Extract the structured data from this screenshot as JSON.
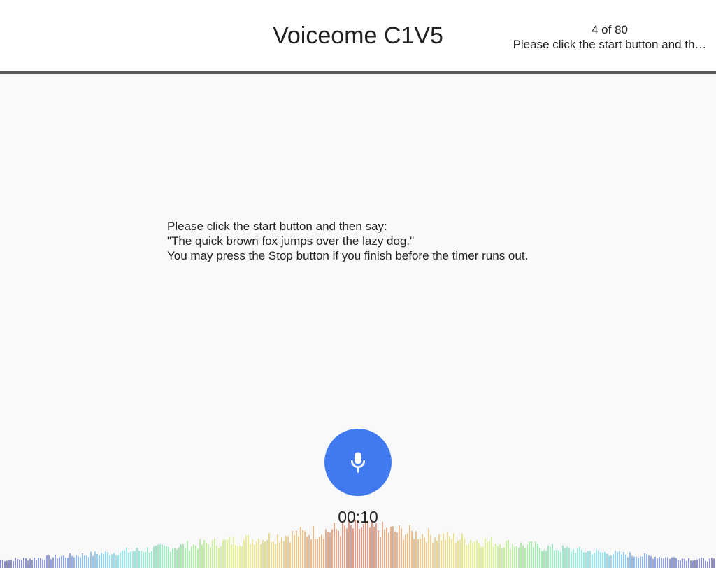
{
  "header": {
    "title": "Voiceome C1V5",
    "progress": {
      "counter": "4 of 80",
      "step_title": "Please click the start button and th…"
    }
  },
  "task": {
    "instruction_lines": [
      "Please click the start button and then say:",
      "\"The quick brown fox jumps over the lazy dog.\"",
      "You may press the Stop button if you finish before the timer runs out."
    ]
  },
  "recorder": {
    "mic_icon": "microphone-icon",
    "timer": "00:10",
    "button_color": "#4079f0"
  },
  "visualizer": {
    "icon": "audio-spectrum",
    "colors": [
      "#1b1b8f",
      "#2e4fd6",
      "#3fd3e6",
      "#4fdc6a",
      "#d8ea3a",
      "#e0952a",
      "#c8331c"
    ]
  }
}
